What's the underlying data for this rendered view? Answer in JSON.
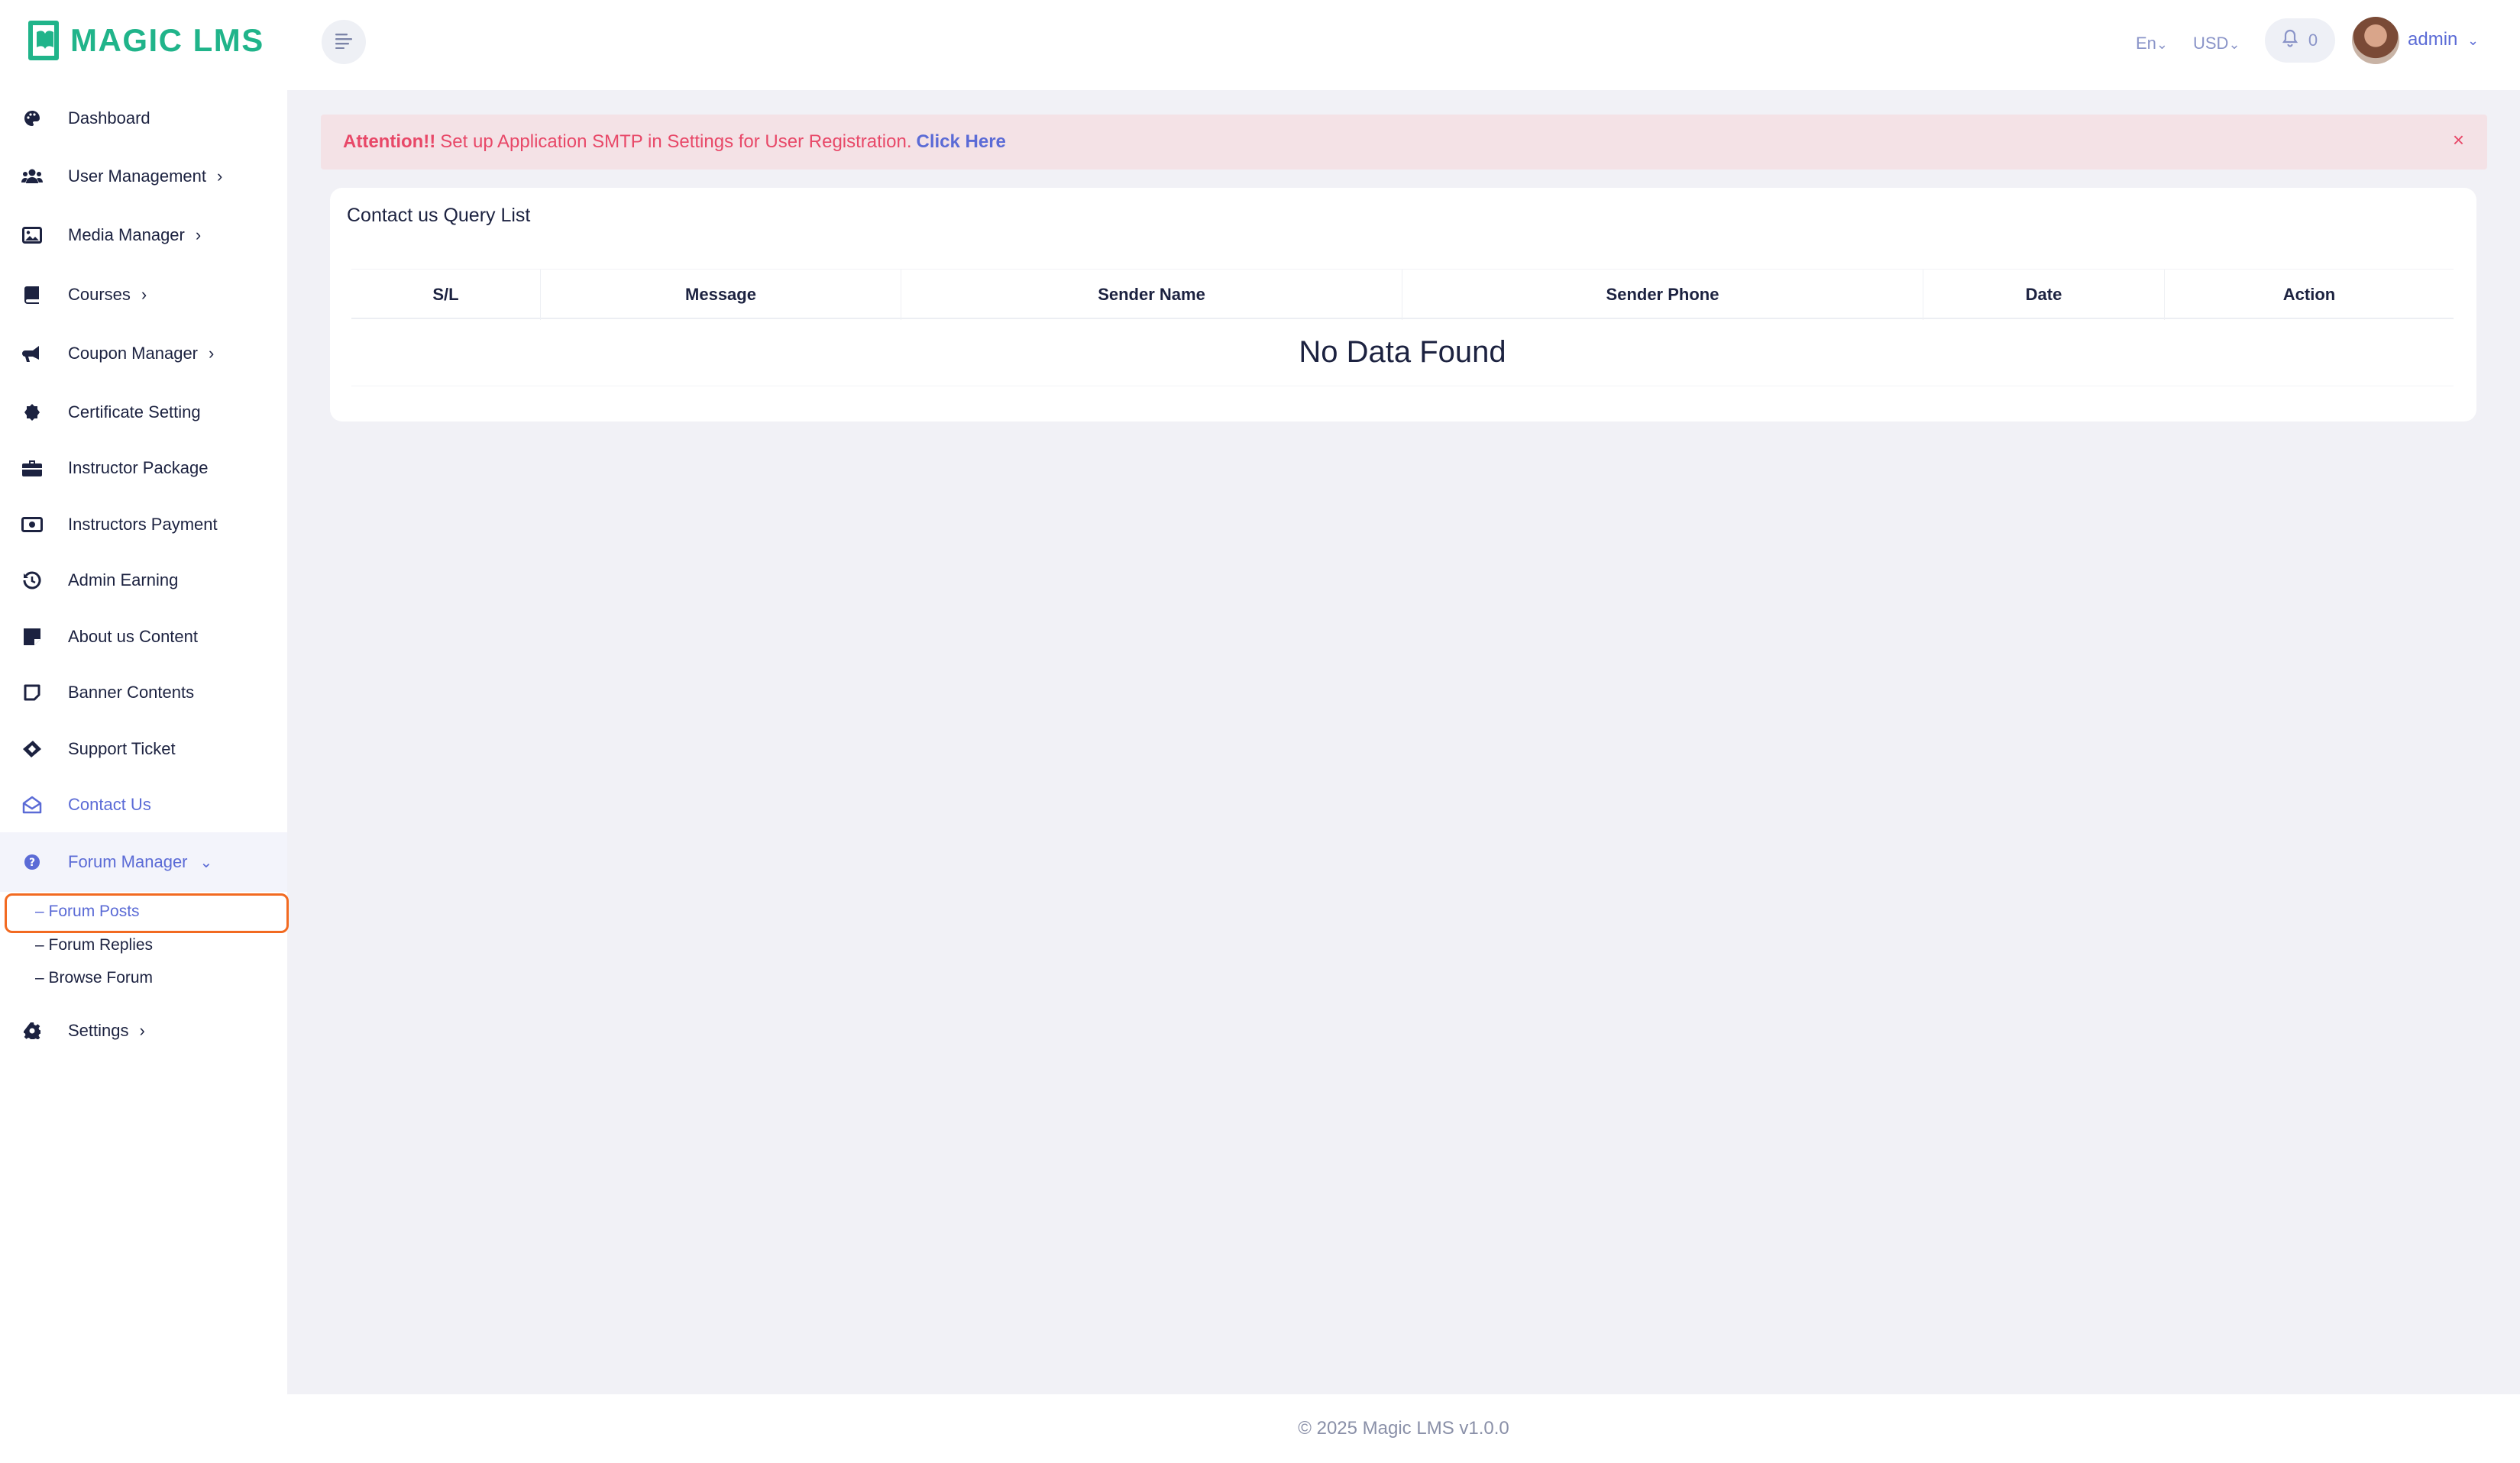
{
  "app": {
    "logo_text": "MAGIC LMS"
  },
  "header": {
    "language": "En",
    "currency": "USD",
    "notification_count": "0",
    "user_name": "admin"
  },
  "sidebar": {
    "items": [
      {
        "label": "Dashboard",
        "icon": "palette-icon"
      },
      {
        "label": "User Management",
        "icon": "users-icon"
      },
      {
        "label": "Media Manager",
        "icon": "image-icon"
      },
      {
        "label": "Courses",
        "icon": "book-icon"
      },
      {
        "label": "Coupon Manager",
        "icon": "megaphone-icon"
      },
      {
        "label": "Certificate Setting",
        "icon": "badge-icon"
      },
      {
        "label": "Instructor Package",
        "icon": "briefcase-icon"
      },
      {
        "label": "Instructors Payment",
        "icon": "money-icon"
      },
      {
        "label": "Admin Earning",
        "icon": "history-icon"
      },
      {
        "label": "About us Content",
        "icon": "note-icon"
      },
      {
        "label": "Banner Contents",
        "icon": "sticky-note-icon"
      },
      {
        "label": "Support Ticket",
        "icon": "ticket-icon"
      },
      {
        "label": "Contact Us",
        "icon": "envelope-open-icon"
      },
      {
        "label": "Forum Manager",
        "icon": "question-circle-icon"
      },
      {
        "label": "Settings",
        "icon": "gear-icon"
      }
    ],
    "forum_subitems": [
      {
        "label": "– Forum Posts"
      },
      {
        "label": "– Forum Replies"
      },
      {
        "label": "– Browse Forum"
      }
    ]
  },
  "alert": {
    "strong": "Attention!!",
    "message": "Set up Application SMTP in Settings for User Registration.",
    "link": "Click Here",
    "close": "×"
  },
  "main": {
    "card_title": "Contact us Query List",
    "columns": [
      "S/L",
      "Message",
      "Sender Name",
      "Sender Phone",
      "Date",
      "Action"
    ],
    "empty_text": "No Data Found"
  },
  "footer": {
    "text": "© 2025 Magic LMS v1.0.0"
  },
  "colors": {
    "brand": "#20b48a",
    "accent": "#5b6bd6",
    "alert": "#e84868",
    "highlight": "#f26a21"
  }
}
